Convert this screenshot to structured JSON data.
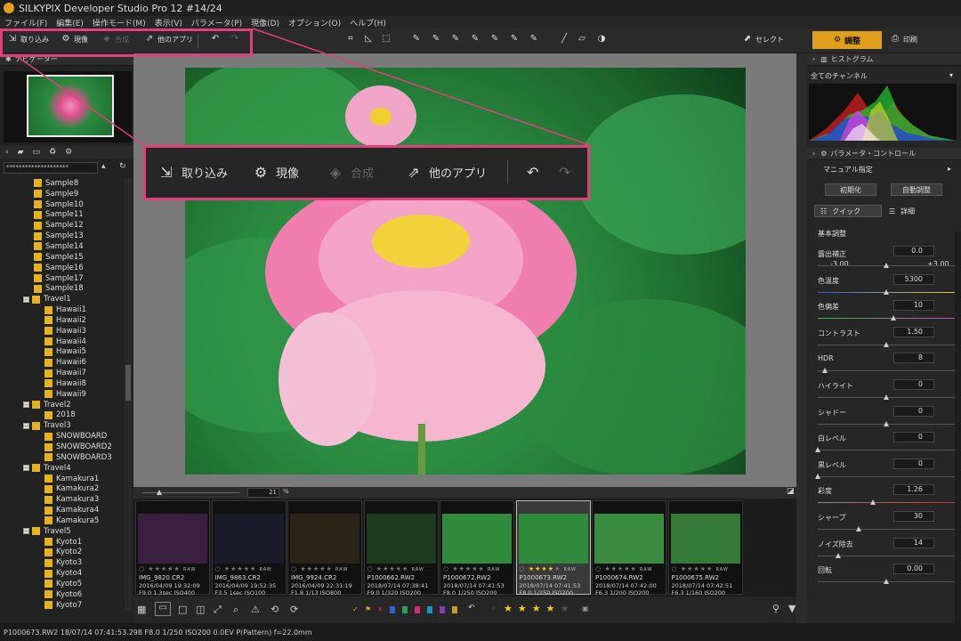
{
  "title": "SILKYPIX Developer Studio Pro 12   #14/24",
  "menu": [
    "ファイル(F)",
    "編集(E)",
    "操作モード(M)",
    "表示(V)",
    "パラメータ(P)",
    "現像(D)",
    "オプション(O)",
    "ヘルプ(H)"
  ],
  "toolbar": {
    "import": "取り込み",
    "develop": "現像",
    "compose": "合成",
    "otherapp": "他のアプリ",
    "select": "セレクト",
    "adjust": "調整",
    "print": "印刷"
  },
  "left": {
    "navigator": "ナビゲーター",
    "path": "********************",
    "tree": [
      {
        "label": "Sample8",
        "indent": 3
      },
      {
        "label": "Sample9",
        "indent": 3
      },
      {
        "label": "Sample10",
        "indent": 3
      },
      {
        "label": "Sample11",
        "indent": 3
      },
      {
        "label": "Sample12",
        "indent": 3
      },
      {
        "label": "Sample13",
        "indent": 3
      },
      {
        "label": "Sample14",
        "indent": 3
      },
      {
        "label": "Sample15",
        "indent": 3
      },
      {
        "label": "Sample16",
        "indent": 3
      },
      {
        "label": "Sample17",
        "indent": 3
      },
      {
        "label": "Sample18",
        "indent": 3
      },
      {
        "label": "Travel1",
        "indent": 2,
        "box": "−"
      },
      {
        "label": "Hawaii1",
        "indent": 4
      },
      {
        "label": "Hawaii2",
        "indent": 4
      },
      {
        "label": "Hawaii3",
        "indent": 4
      },
      {
        "label": "Hawaii4",
        "indent": 4
      },
      {
        "label": "Hawaii5",
        "indent": 4
      },
      {
        "label": "Hawaii6",
        "indent": 4
      },
      {
        "label": "Hawaii7",
        "indent": 4
      },
      {
        "label": "Hawaii8",
        "indent": 4
      },
      {
        "label": "Hawaii9",
        "indent": 4
      },
      {
        "label": "Travel2",
        "indent": 2,
        "box": "−"
      },
      {
        "label": "2018",
        "indent": 4
      },
      {
        "label": "Travel3",
        "indent": 2,
        "box": "−"
      },
      {
        "label": "SNOWBOARD",
        "indent": 4
      },
      {
        "label": "SNOWBOARD2",
        "indent": 4
      },
      {
        "label": "SNOWBOARD3",
        "indent": 4
      },
      {
        "label": "Travel4",
        "indent": 2,
        "box": "−"
      },
      {
        "label": "Kamakura1",
        "indent": 4
      },
      {
        "label": "Kamakura2",
        "indent": 4
      },
      {
        "label": "Kamakura3",
        "indent": 4
      },
      {
        "label": "Kamakura4",
        "indent": 4
      },
      {
        "label": "Kamakura5",
        "indent": 4
      },
      {
        "label": "Travel5",
        "indent": 2,
        "box": "−"
      },
      {
        "label": "Kyoto1",
        "indent": 4
      },
      {
        "label": "Kyoto2",
        "indent": 4
      },
      {
        "label": "Kyoto3",
        "indent": 4
      },
      {
        "label": "Kyoto4",
        "indent": 4
      },
      {
        "label": "Kyoto5",
        "indent": 4
      },
      {
        "label": "Kyoto6",
        "indent": 4
      },
      {
        "label": "Kyoto7",
        "indent": 4
      }
    ]
  },
  "zoom": "21",
  "zoom_unit": "%",
  "thumbs": [
    {
      "name": "IMG_9820.CR2",
      "meta1": "2016/04/09 19:32:09",
      "meta2": "F9.0 1.3sec ISO400",
      "bg": "#3a2040",
      "stars": 0
    },
    {
      "name": "IMG_9863.CR2",
      "meta1": "2016/04/09 19:52:35",
      "meta2": "F3.5 1sec ISO100",
      "bg": "#1a1a28",
      "stars": 0
    },
    {
      "name": "IMG_9924.CR2",
      "meta1": "2016/04/09 22:31:19",
      "meta2": "F1.8 1/13 ISO800",
      "bg": "#2a2418",
      "stars": 0
    },
    {
      "name": "P1000662.RW2",
      "meta1": "2018/07/14 07:38:41",
      "meta2": "F9.0 1/320 ISO200",
      "bg": "#1e3a1e",
      "stars": 0
    },
    {
      "name": "P1000672.RW2",
      "meta1": "2018/07/14 07:41:53",
      "meta2": "F8.0 1/250 ISO200",
      "bg": "#2f8a3c",
      "stars": 0
    },
    {
      "name": "P1000673.RW2",
      "meta1": "2018/07/14 07:41:53",
      "meta2": "F8.0 1/250 ISO200",
      "bg": "#2f8a3c",
      "stars": 4,
      "selected": true
    },
    {
      "name": "P1000674.RW2",
      "meta1": "2018/07/14 07:42:00",
      "meta2": "F6.3 1/200 ISO200",
      "bg": "#3a8a40",
      "stars": 0
    },
    {
      "name": "P1000675.RW2",
      "meta1": "2018/07/14 07:42:51",
      "meta2": "F6.3 1/160 ISO200",
      "bg": "#357a38",
      "stars": 0
    }
  ],
  "status": "P1000673.RW2 18/07/14 07:41:53.298 F8.0 1/250 ISO200  0.0EV P(Pattern) f=22.0mm",
  "right": {
    "histogram": "ヒストグラム",
    "channel": "全てのチャンネル",
    "param": "パラメータ・コントロール",
    "preset": "マニュアル指定",
    "init": "初期化",
    "auto": "自動調整",
    "quick": "クイック",
    "detail": "詳細",
    "basic": "基本調整",
    "sliders": [
      {
        "label": "露出補正",
        "value": "0.0",
        "pos": 0.5,
        "min": "-3.00",
        "max": "+3.00"
      },
      {
        "label": "色温度",
        "value": "5300",
        "pos": 0.5
      },
      {
        "label": "色偏差",
        "value": "10",
        "pos": 0.55
      },
      {
        "label": "コントラスト",
        "value": "1.50",
        "pos": 0.5
      },
      {
        "label": "HDR",
        "value": "8",
        "pos": 0.05
      },
      {
        "label": "ハイライト",
        "value": "0",
        "pos": 0.5
      },
      {
        "label": "シャドー",
        "value": "0",
        "pos": 0.5
      },
      {
        "label": "白レベル",
        "value": "0",
        "pos": 0.0
      },
      {
        "label": "黒レベル",
        "value": "0",
        "pos": 0.0
      },
      {
        "label": "彩度",
        "value": "1.26",
        "pos": 0.4
      },
      {
        "label": "シャープ",
        "value": "30",
        "pos": 0.3
      },
      {
        "label": "ノイズ除去",
        "value": "14",
        "pos": 0.15
      },
      {
        "label": "回転",
        "value": "0.00",
        "pos": 0.5
      }
    ]
  }
}
